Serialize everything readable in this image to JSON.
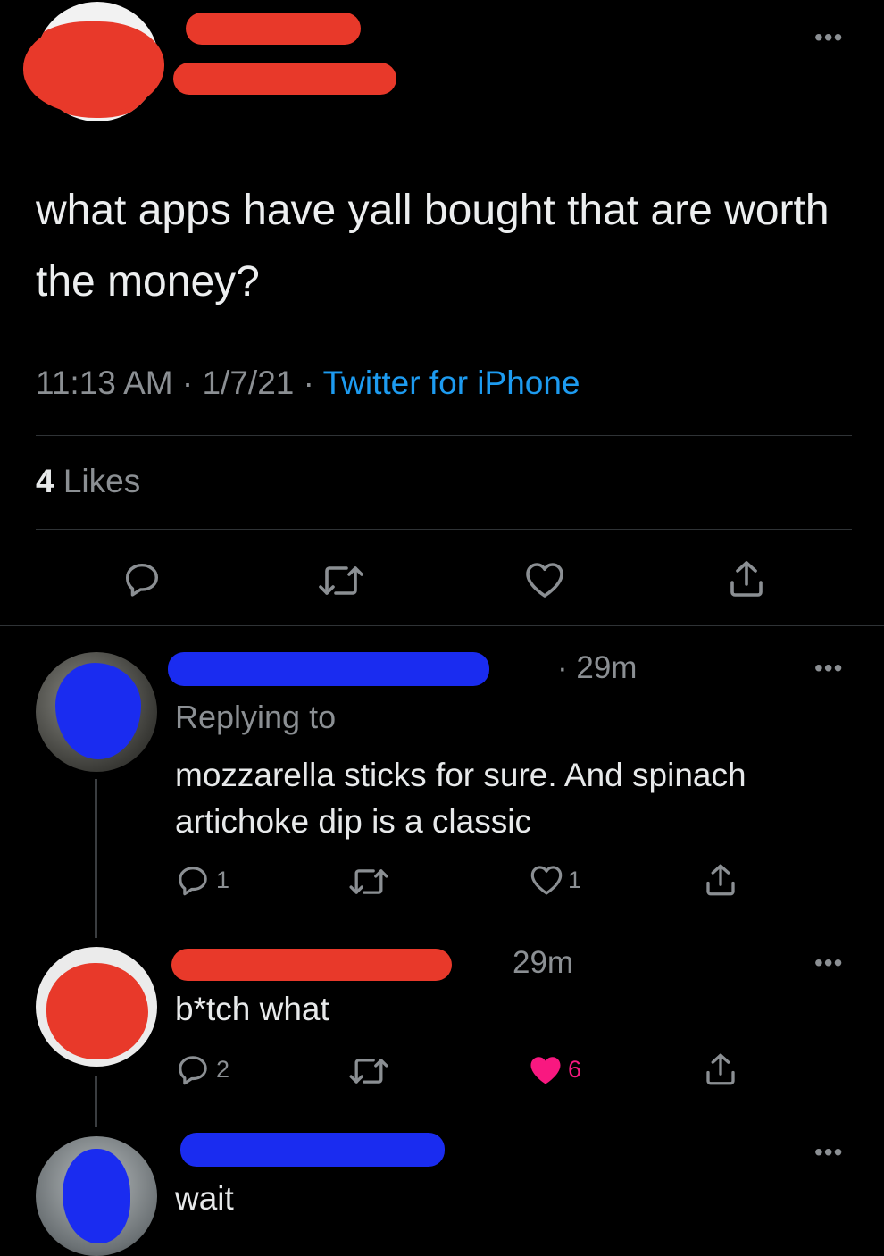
{
  "tweet": {
    "text": "what apps have yall bought that are worth the money?",
    "time": "11:13 AM",
    "date": "1/7/21",
    "source": "Twitter for iPhone",
    "likes_count": "4",
    "likes_label": "Likes",
    "sep": "·"
  },
  "comments": [
    {
      "time": "· 29m",
      "replying_to": "Replying to",
      "text": "mozzarella sticks for sure. And spinach artichoke dip is a classic",
      "reply_count": "1",
      "like_count": "1"
    },
    {
      "time": "29m",
      "text": "b*tch what",
      "reply_count": "2",
      "like_count": "6"
    },
    {
      "text": "wait"
    }
  ],
  "colors": {
    "background": "#000000",
    "link": "#1d9bf0",
    "liked": "#f91880",
    "redaction_red": "#e8392a",
    "redaction_blue": "#1a2cf0"
  },
  "icons": [
    "reply-icon",
    "retweet-icon",
    "like-icon",
    "share-icon",
    "more-icon"
  ]
}
